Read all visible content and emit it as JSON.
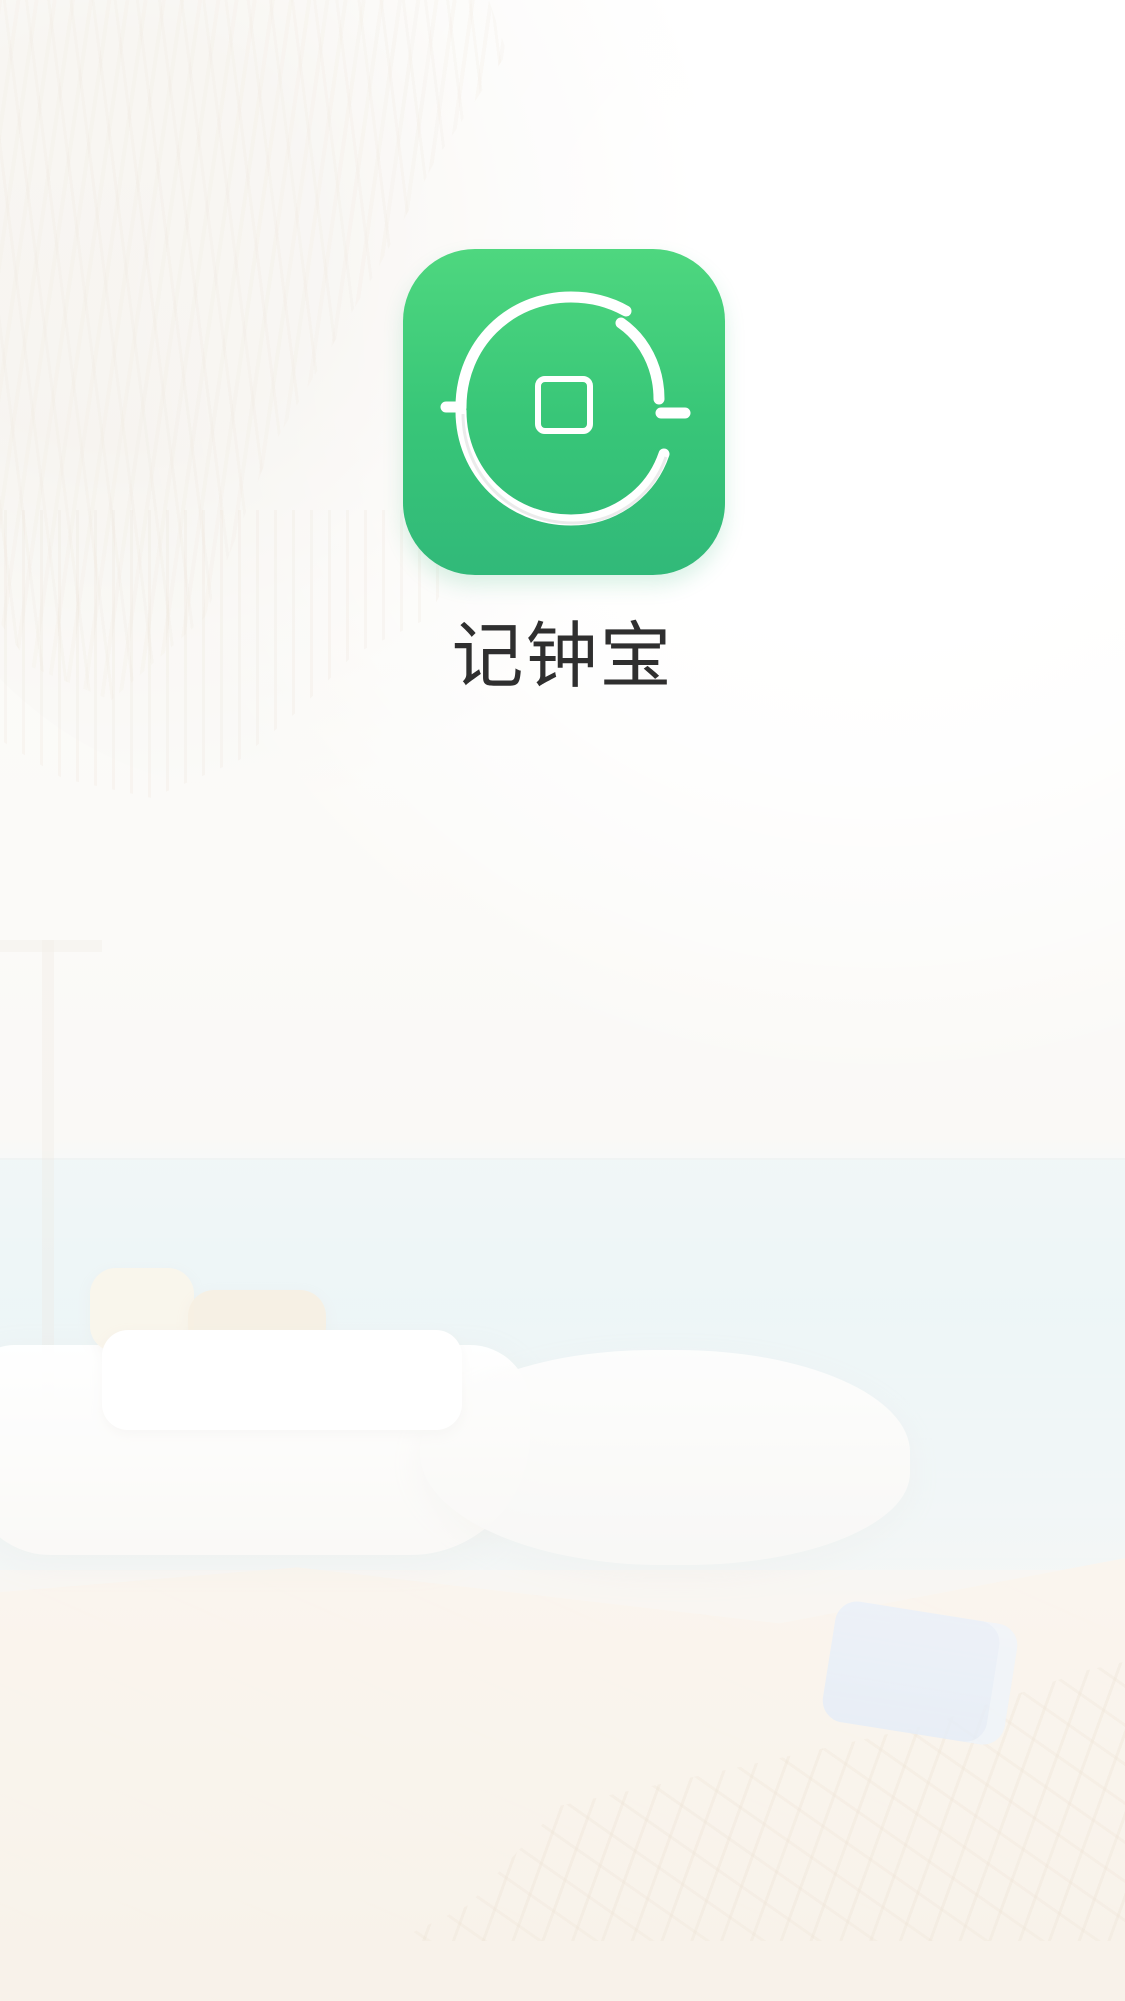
{
  "app": {
    "name": "记钟宝",
    "icon_name": "record-clock-icon"
  },
  "theme": {
    "brand_green_top": "#4ed77f",
    "brand_green_bottom": "#31b979",
    "text_color": "#2f2f2f"
  }
}
